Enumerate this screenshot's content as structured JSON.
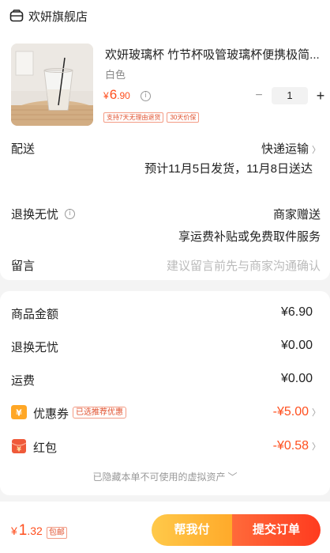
{
  "store": {
    "name": "欢妍旗舰店"
  },
  "product": {
    "title": "欢妍玻璃杯 竹节杯吸管玻璃杯便携极简...",
    "variant": "白色",
    "price_symbol": "¥",
    "price_int": "6",
    "price_dec": ".90",
    "quantity": "1",
    "minus": "−",
    "plus": "+",
    "tags": [
      "支持7天无理由退货",
      "30天价保"
    ]
  },
  "shipping": {
    "label": "配送",
    "method": "快递运输",
    "estimate": "预计11月5日发货，11月8日送达"
  },
  "returns": {
    "label": "退换无忧",
    "value": "商家赠送",
    "desc": "享运费补贴或免费取件服务"
  },
  "message": {
    "label": "留言",
    "placeholder": "建议留言前先与商家沟通确认"
  },
  "summary": {
    "goods_label": "商品金额",
    "goods_value": "¥6.90",
    "returns_label": "退换无忧",
    "returns_value": "¥0.00",
    "freight_label": "运费",
    "freight_value": "¥0.00",
    "coupon_label": "优惠券",
    "coupon_badge": "已选推荐优惠",
    "coupon_value": "-¥5.00",
    "redpacket_label": "红包",
    "redpacket_value": "-¥0.58",
    "hidden_note": "已隐藏本单不可使用的虚拟资产"
  },
  "bottom": {
    "total_symbol": "¥",
    "total_int": "1",
    "total_dec": ".32",
    "pkg_badge": "包邮",
    "help_pay": "帮我付",
    "pay": "提交订单"
  },
  "colors": {
    "accent": "#ff4f1e",
    "tag_border": "#f39b84",
    "help_btn": "#ffb33a",
    "pay_btn": "#ff4a22"
  },
  "icons": [
    "store-icon",
    "info-icon",
    "chevron-right-icon",
    "coupon-icon",
    "redpacket-icon",
    "chevron-down-icon"
  ]
}
